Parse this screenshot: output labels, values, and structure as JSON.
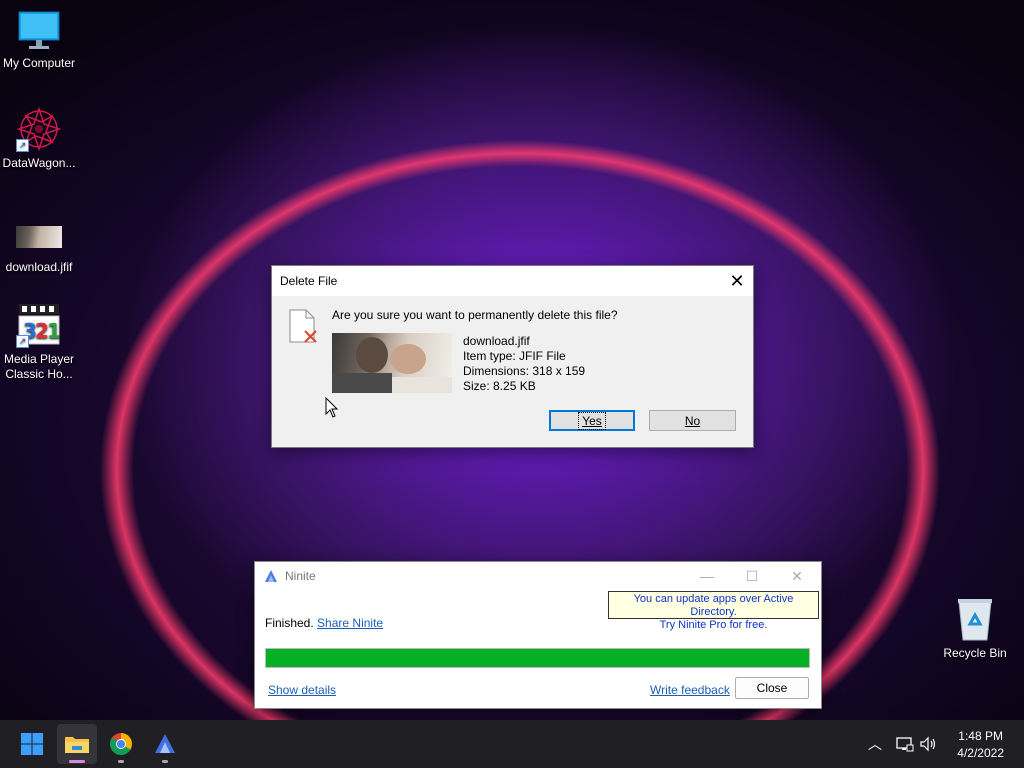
{
  "desktop": {
    "icons": [
      {
        "label": "My Computer",
        "icon": "monitor-icon"
      },
      {
        "label": "DataWagon...",
        "icon": "datawagon-icon"
      },
      {
        "label": "download.jfif",
        "icon": "image-thumbnail-icon"
      },
      {
        "label": "Media Player Classic Ho...",
        "label_line1": "Media Player",
        "label_line2": "Classic Ho...",
        "icon": "mpc-hc-icon"
      },
      {
        "label": "Recycle Bin",
        "icon": "recycle-bin-icon"
      }
    ]
  },
  "delete_dialog": {
    "title": "Delete File",
    "question": "Are you sure you want to permanently delete this file?",
    "file_name": "download.jfif",
    "item_type": "Item type: JFIF File",
    "dimensions": "Dimensions: 318 x 159",
    "size": "Size: 8.25 KB",
    "yes_label": "Yes",
    "no_label": "No"
  },
  "ninite": {
    "title": "Ninite",
    "promo_line1": "You can update apps over Active Directory.",
    "promo_line2": "Try Ninite Pro for free.",
    "status": "Finished.",
    "share_link": "Share Ninite",
    "progress": 1.0,
    "show_details": "Show details",
    "write_feedback": "Write feedback",
    "close_label": "Close",
    "progress_color": "#06b025"
  },
  "taskbar": {
    "apps": [
      {
        "name": "start",
        "icon": "windows-start-icon"
      },
      {
        "name": "file-explorer",
        "icon": "folder-icon",
        "active": true
      },
      {
        "name": "chrome",
        "icon": "chrome-icon"
      },
      {
        "name": "ninite",
        "icon": "ninite-icon"
      }
    ],
    "time": "1:48 PM",
    "date": "4/2/2022"
  }
}
